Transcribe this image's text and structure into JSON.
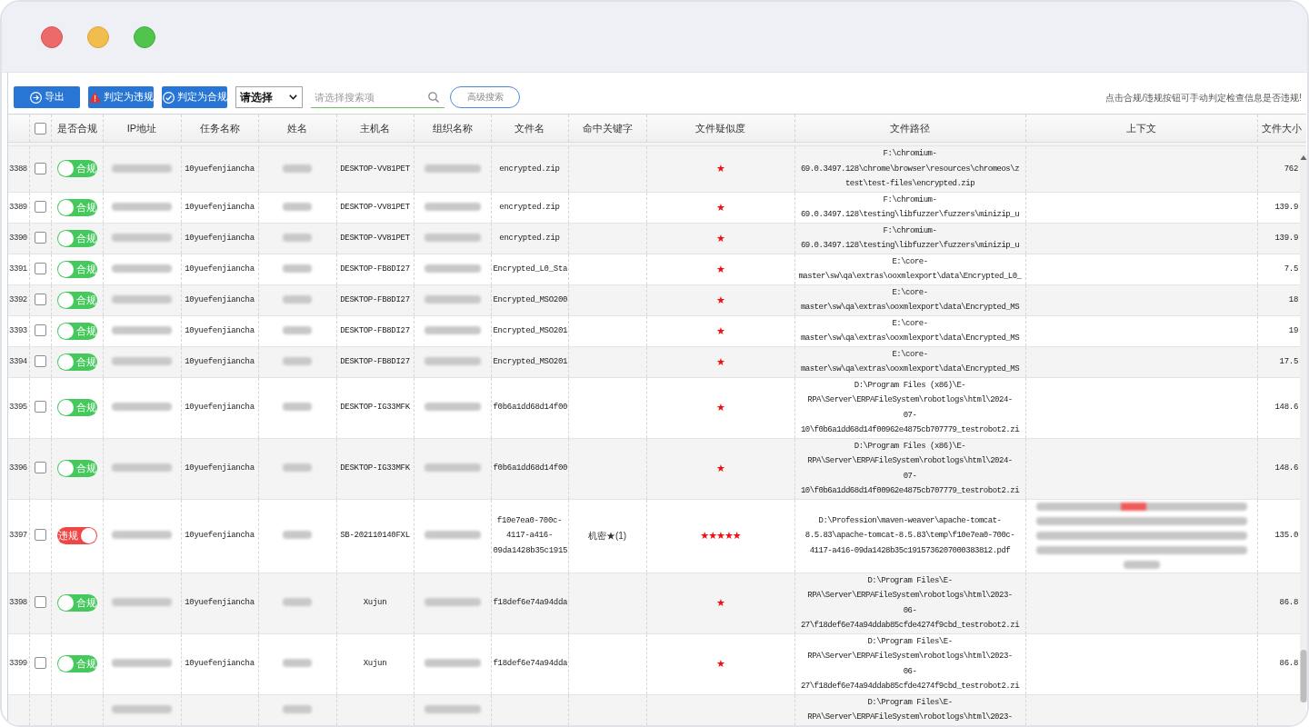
{
  "toolbar": {
    "buttons": [
      {
        "label": "导出",
        "kind": "export"
      },
      {
        "label": "判定为违规",
        "kind": "violation"
      },
      {
        "label": "判定为合规",
        "kind": "compliant"
      }
    ],
    "select": {
      "value": "请选择"
    },
    "search": {
      "placeholder": "请选择搜索项"
    },
    "advanced_search": {
      "label": "高级搜索"
    },
    "hint": "点击合规/违规按钮可手动判定检查信息是否违规!"
  },
  "table": {
    "select_all": {
      "checked": false
    },
    "columns": [
      {
        "label": "是否合规",
        "kind": "toggle"
      },
      {
        "label": "IP地址",
        "kind": "ip"
      },
      {
        "label": "任务名称",
        "kind": "task"
      },
      {
        "label": "姓名",
        "kind": "name"
      },
      {
        "label": "主机名",
        "kind": "host"
      },
      {
        "label": "组织名称",
        "kind": "org"
      },
      {
        "label": "文件名",
        "kind": "file"
      },
      {
        "label": "命中关键字",
        "kind": "keyword"
      },
      {
        "label": "文件疑似度",
        "kind": "similarity"
      },
      {
        "label": "文件路径",
        "kind": "path"
      },
      {
        "label": "上下文",
        "kind": "context"
      },
      {
        "label": "文件大小",
        "kind": "size"
      }
    ],
    "rows": [
      {
        "number": "3388",
        "checked": false,
        "violation": false,
        "status": "合规",
        "task": "10yuefenjiancha",
        "host": "DESKTOP-VV81PET",
        "file": "encrypted.zip",
        "similarity": "★",
        "path": "F:\\chromium-\n69.0.3497.128\\chrome\\browser\\resources\\chromeos\\z\ntest\\test-files\\encrypted.zip",
        "context_blurred": false,
        "size": "762"
      },
      {
        "number": "3389",
        "checked": false,
        "violation": false,
        "status": "合规",
        "task": "10yuefenjiancha",
        "host": "DESKTOP-VV81PET",
        "file": "encrypted.zip",
        "similarity": "★",
        "path": "F:\\chromium-\n69.0.3497.128\\testing\\libfuzzer\\fuzzers\\minizip_u",
        "context_blurred": false,
        "size": "139.9"
      },
      {
        "number": "3390",
        "checked": false,
        "violation": false,
        "status": "合规",
        "task": "10yuefenjiancha",
        "host": "DESKTOP-VV81PET",
        "file": "encrypted.zip",
        "similarity": "★",
        "path": "F:\\chromium-\n69.0.3497.128\\testing\\libfuzzer\\fuzzers\\minizip_u",
        "context_blurred": false,
        "size": "139.9"
      },
      {
        "number": "3391",
        "checked": false,
        "violation": false,
        "status": "合规",
        "task": "10yuefenjiancha",
        "host": "DESKTOP-FB8DI27",
        "file": "Encrypted_L0_Sta",
        "similarity": "★",
        "path": "E:\\core-\nmaster\\sw\\qa\\extras\\ooxmlexport\\data\\Encrypted_L0_",
        "context_blurred": false,
        "size": "7.5"
      },
      {
        "number": "3392",
        "checked": false,
        "violation": false,
        "status": "合规",
        "task": "10yuefenjiancha",
        "host": "DESKTOP-FB8DI27",
        "file": "Encrypted_MSO200",
        "similarity": "★",
        "path": "E:\\core-\nmaster\\sw\\qa\\extras\\ooxmlexport\\data\\Encrypted_MS",
        "context_blurred": false,
        "size": "18"
      },
      {
        "number": "3393",
        "checked": false,
        "violation": false,
        "status": "合规",
        "task": "10yuefenjiancha",
        "host": "DESKTOP-FB8DI27",
        "file": "Encrypted_MSO201",
        "similarity": "★",
        "path": "E:\\core-\nmaster\\sw\\qa\\extras\\ooxmlexport\\data\\Encrypted_MS",
        "context_blurred": false,
        "size": "19"
      },
      {
        "number": "3394",
        "checked": false,
        "violation": false,
        "status": "合规",
        "task": "10yuefenjiancha",
        "host": "DESKTOP-FB8DI27",
        "file": "Encrypted_MSO201",
        "similarity": "★",
        "path": "E:\\core-\nmaster\\sw\\qa\\extras\\ooxmlexport\\data\\Encrypted_MS",
        "context_blurred": false,
        "size": "17.5"
      },
      {
        "number": "3395",
        "checked": false,
        "violation": false,
        "status": "合规",
        "task": "10yuefenjiancha",
        "host": "DESKTOP-IG33MFK",
        "file": "f0b6a1dd68d14f00",
        "similarity": "★",
        "path": "D:\\Program Files (x86)\\E-\nRPA\\Server\\ERPAFileSystem\\robotlogs\\html\\2024-\n07-\n10\\f0b6a1dd68d14f00962e4875cb707779_testrobot2.zi",
        "context_blurred": false,
        "size": "148.6"
      },
      {
        "number": "3396",
        "checked": false,
        "violation": false,
        "status": "合规",
        "task": "10yuefenjiancha",
        "host": "DESKTOP-IG33MFK",
        "file": "f0b6a1dd68d14f00",
        "similarity": "★",
        "path": "D:\\Program Files (x86)\\E-\nRPA\\Server\\ERPAFileSystem\\robotlogs\\html\\2024-\n07-\n10\\f0b6a1dd68d14f00962e4875cb707779_testrobot2.zi",
        "context_blurred": false,
        "size": "148.6"
      },
      {
        "number": "3397",
        "checked": false,
        "violation": true,
        "status": "违规",
        "task": "10yuefenjiancha",
        "host": "SB-202110140FXL",
        "file": "f10e7ea0-700c-\n4117-a416-\n09da1428b35c1915",
        "keyword": "机密★(1)",
        "similarity": "★★★★★",
        "path": "D:\\Profession\\maven-weaver\\apache-tomcat-\n8.5.83\\apache-tomcat-8.5.83\\temp\\f10e7ea0-700c-\n4117-a416-09da1428b35c1915736207000383812.pdf",
        "context_blurred": true,
        "size": "135.0"
      },
      {
        "number": "3398",
        "checked": false,
        "violation": false,
        "status": "合规",
        "task": "10yuefenjiancha",
        "host": "Xujun",
        "file": "f18def6e74a94dda",
        "similarity": "★",
        "path": "D:\\Program Files\\E-\nRPA\\Server\\ERPAFileSystem\\robotlogs\\html\\2023-\n06-\n27\\f18def6e74a94ddab85cfde4274f9cbd_testrobot2.zi",
        "context_blurred": false,
        "size": "86.8"
      },
      {
        "number": "3399",
        "checked": false,
        "violation": false,
        "status": "合规",
        "task": "10yuefenjiancha",
        "host": "Xujun",
        "file": "f18def6e74a94dda",
        "similarity": "★",
        "path": "D:\\Program Files\\E-\nRPA\\Server\\ERPAFileSystem\\robotlogs\\html\\2023-\n06-\n27\\f18def6e74a94ddab85cfde4274f9cbd_testrobot2.zi",
        "context_blurred": false,
        "size": "86.8"
      },
      {
        "path": "D:\\Program Files\\E-\nRPA\\Server\\ERPAFileSystem\\robotlogs\\html\\2023-",
        "context_blurred": false
      }
    ]
  }
}
